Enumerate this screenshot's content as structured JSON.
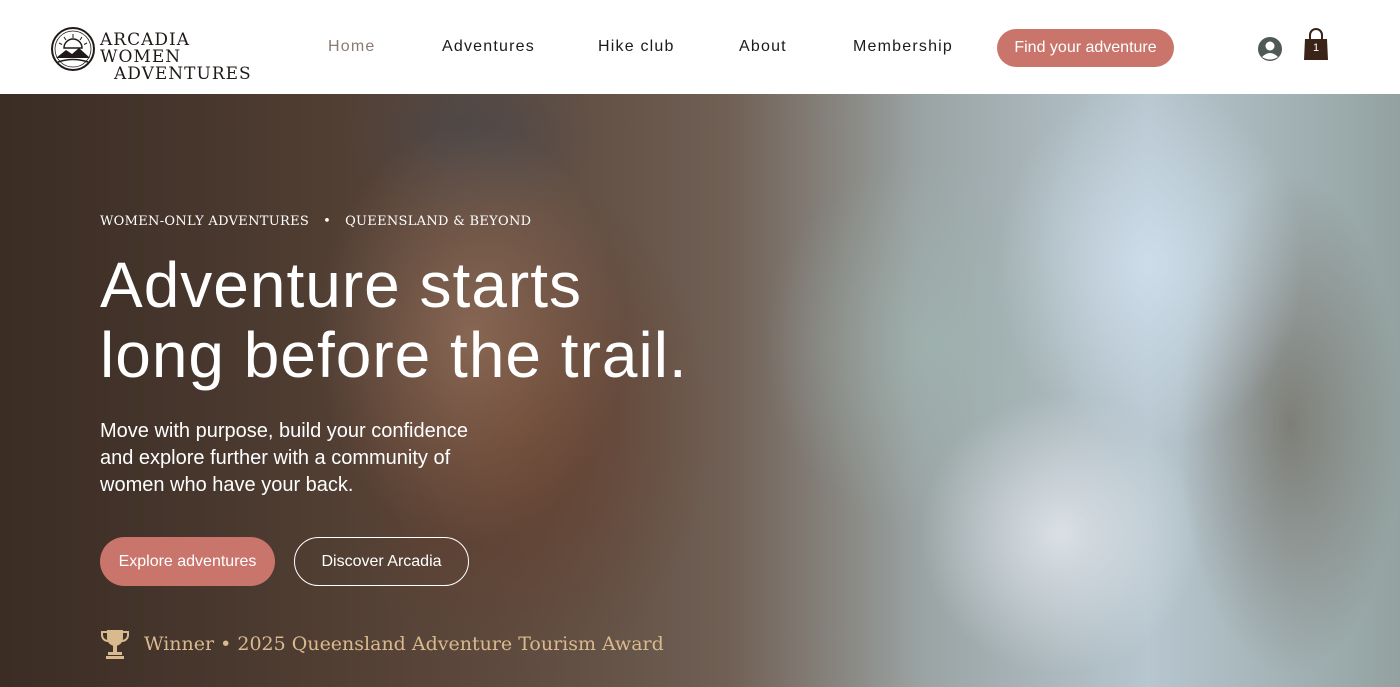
{
  "brand": {
    "name_line1": "Arcadia Women",
    "name_line2": "Adventures",
    "logo_icon": "mountain-sun-logo-icon"
  },
  "nav": {
    "items": [
      {
        "label": "Home",
        "active": true
      },
      {
        "label": "Adventures",
        "active": false
      },
      {
        "label": "Hike club",
        "active": false
      },
      {
        "label": "About",
        "active": false
      },
      {
        "label": "Membership",
        "active": false
      }
    ],
    "cta_label": "Find your adventure",
    "account_icon": "user-account-icon",
    "cart_icon": "shopping-bag-icon",
    "cart_count": "1"
  },
  "hero": {
    "eyebrow_left": "WOMEN-ONLY ADVENTURES",
    "eyebrow_separator": "•",
    "eyebrow_right": "QUEENSLAND & BEYOND",
    "headline_line1": "Adventure starts",
    "headline_line2": "long before the trail.",
    "subtext": "Move with purpose, build your confidence and explore further with a community of women who have your back.",
    "primary_button": "Explore adventures",
    "secondary_button": "Discover Arcadia",
    "award_icon": "trophy-icon",
    "award_text": "Winner • 2025 Queensland Adventure Tourism Award"
  },
  "colors": {
    "accent": "#c9756b",
    "text_dark": "#1f1a17",
    "nav_active": "#8a7b72",
    "award_gold": "#d9b98e"
  }
}
